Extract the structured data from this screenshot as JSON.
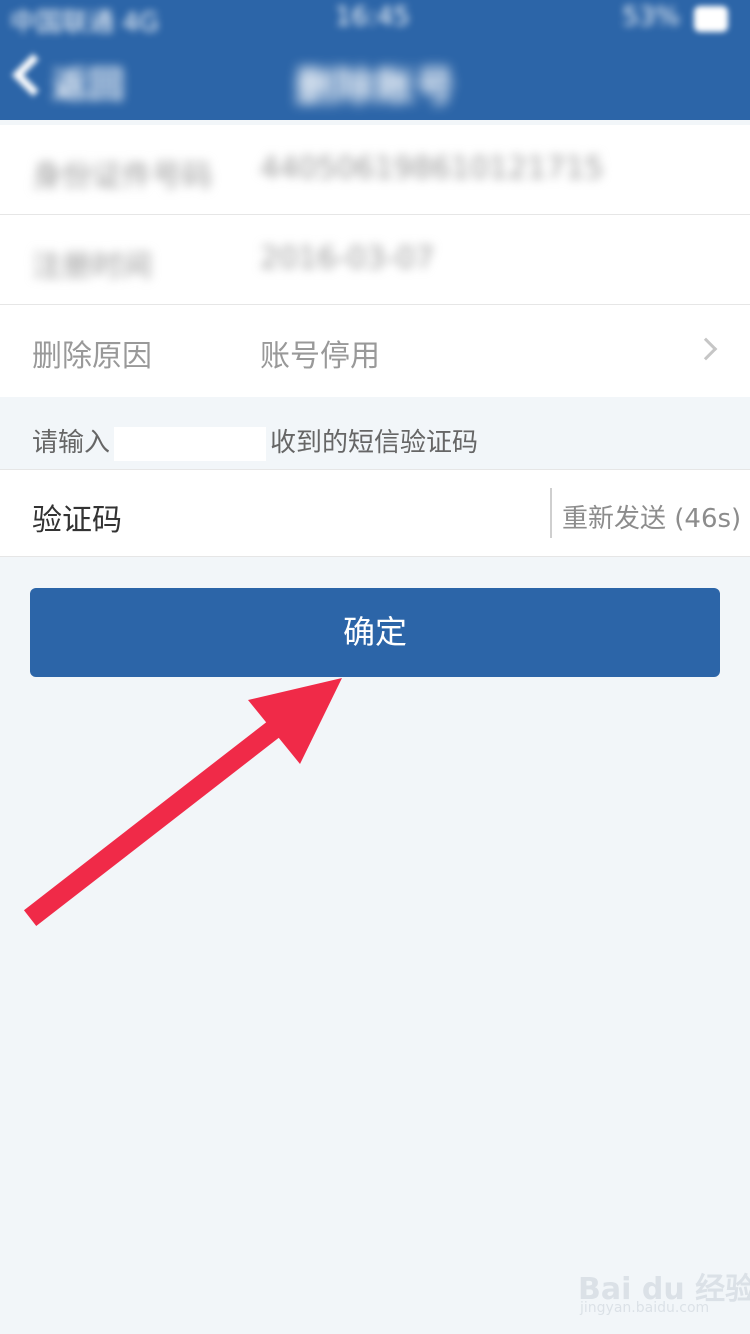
{
  "status_bar": {
    "carrier": "中国联通 4G",
    "time": "16:45",
    "battery": "53%"
  },
  "nav": {
    "back_label": "返回",
    "title": "删除账号"
  },
  "info_rows": [
    {
      "label": "身份证件号码",
      "value": "440506198610121715"
    },
    {
      "label": "注册时间",
      "value": "2016-03-07"
    },
    {
      "label": "删除原因",
      "value": "账号停用"
    }
  ],
  "sms_hint": {
    "prefix": "请输入",
    "suffix": "收到的短信验证码"
  },
  "code_field": {
    "label": "验证码",
    "value": "",
    "resend_label": "重新发送 (46s)"
  },
  "confirm_label": "确定",
  "watermark": {
    "brand": "Bai du 经验",
    "url": "jingyan.baidu.com"
  },
  "colors": {
    "primary": "#2c65a8",
    "arrow": "#f02a48",
    "background": "#f2f6f9"
  }
}
